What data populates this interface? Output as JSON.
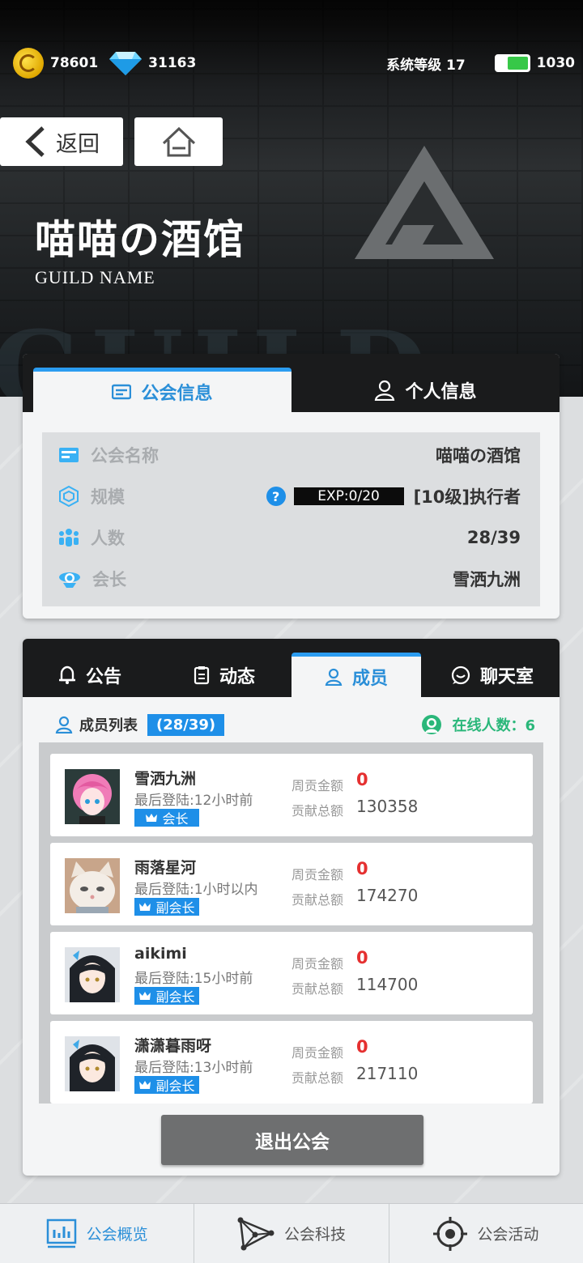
{
  "status": {
    "coins": "78601",
    "gems": "31163",
    "system_level": "系统等级 17",
    "energy": "1030"
  },
  "nav": {
    "back_label": "返回"
  },
  "guild": {
    "title": "喵喵の酒馆",
    "subtitle": "GUILD NAME"
  },
  "info_tabs": [
    "公会信息",
    "个人信息"
  ],
  "info": {
    "name_label": "公会名称",
    "name_value": "喵喵の酒馆",
    "scale_label": "规模",
    "exp_help": "?",
    "exp_text": "EXP:0/20",
    "scale_value": "[10级]执行者",
    "count_label": "人数",
    "count_value": "28/39",
    "leader_label": "会长",
    "leader_value": "雪洒九洲"
  },
  "member_tabs": [
    "公告",
    "动态",
    "成员",
    "聊天室"
  ],
  "members_header": {
    "title": "成员列表",
    "count": "(28/39)",
    "online": "在线人数：6"
  },
  "members": [
    {
      "name": "雪洒九洲",
      "last_login": "最后登陆:12小时前",
      "role": "会长",
      "weekly_label": "周贡金额",
      "weekly": "0",
      "total_label": "贡献总额",
      "total": "130358"
    },
    {
      "name": "雨落星河",
      "last_login": "最后登陆:1小时以内",
      "role": "副会长",
      "weekly_label": "周贡金额",
      "weekly": "0",
      "total_label": "贡献总额",
      "total": "174270"
    },
    {
      "name": "aikimi",
      "last_login": "最后登陆:15小时前",
      "role": "副会长",
      "weekly_label": "周贡金额",
      "weekly": "0",
      "total_label": "贡献总额",
      "total": "114700"
    },
    {
      "name": "潇潇暮雨呀",
      "last_login": "最后登陆:13小时前",
      "role": "副会长",
      "weekly_label": "周贡金额",
      "weekly": "0",
      "total_label": "贡献总额",
      "total": "217110"
    }
  ],
  "quit_label": "退出公会",
  "bottom_nav": [
    "公会概览",
    "公会科技",
    "公会活动"
  ],
  "colors": {
    "accent": "#2b8fd8",
    "online": "#2ab77a",
    "weekly": "#e53030"
  }
}
